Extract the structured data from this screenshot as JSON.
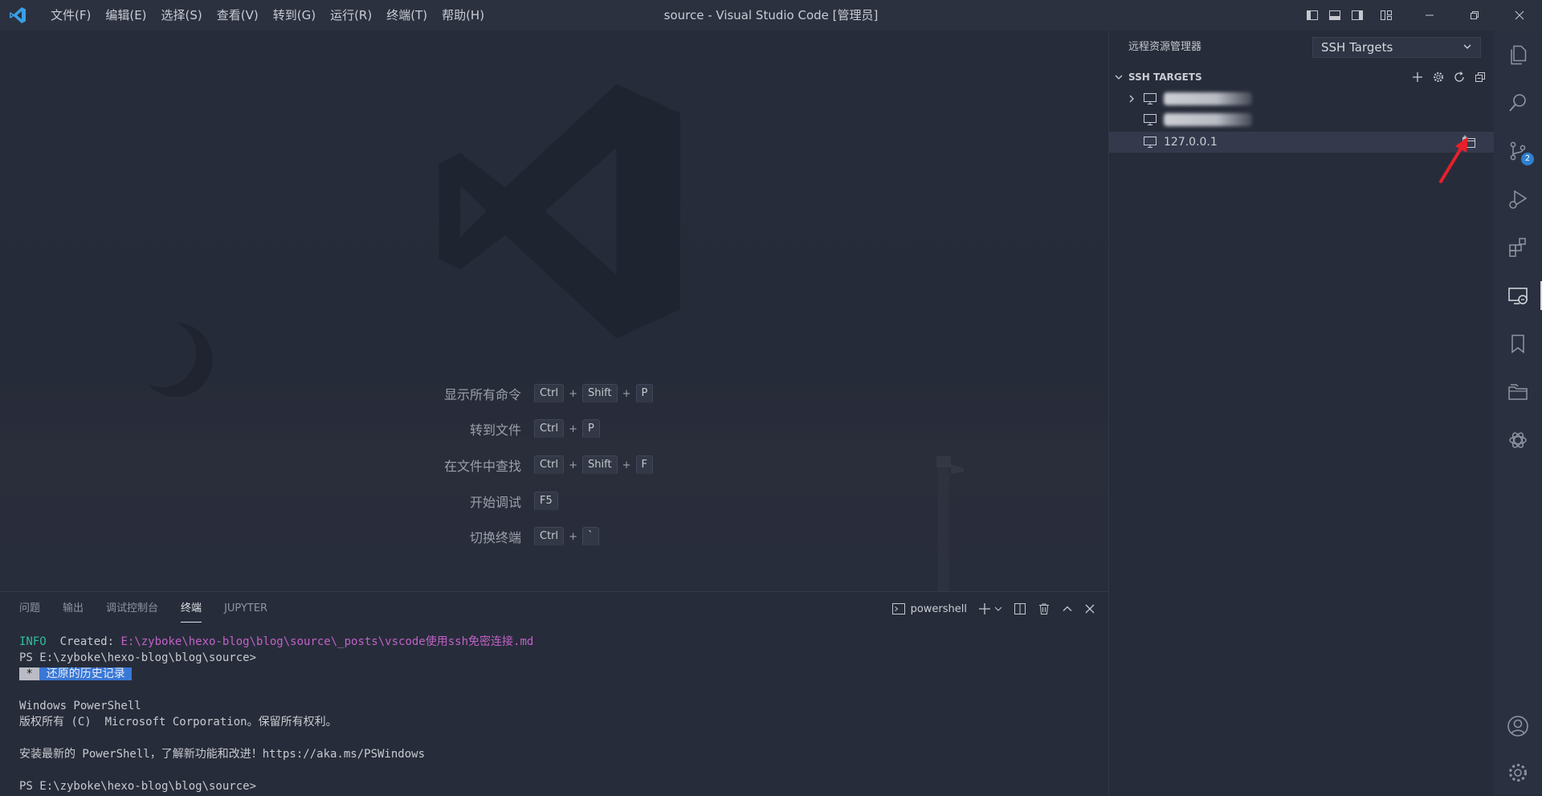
{
  "titlebar": {
    "menu": [
      "文件(F)",
      "编辑(E)",
      "选择(S)",
      "查看(V)",
      "转到(G)",
      "运行(R)",
      "终端(T)",
      "帮助(H)"
    ],
    "window_title": "source - Visual Studio Code [管理员]"
  },
  "editor": {
    "shortcuts": [
      {
        "label": "显示所有命令",
        "keys": [
          "Ctrl",
          "Shift",
          "P"
        ]
      },
      {
        "label": "转到文件",
        "keys": [
          "Ctrl",
          "P"
        ]
      },
      {
        "label": "在文件中查找",
        "keys": [
          "Ctrl",
          "Shift",
          "F"
        ]
      },
      {
        "label": "开始调试",
        "keys": [
          "F5"
        ]
      },
      {
        "label": "切换终端",
        "keys": [
          "Ctrl",
          "`"
        ]
      }
    ]
  },
  "panel": {
    "tabs": [
      "问题",
      "输出",
      "调试控制台",
      "终端",
      "JUPYTER"
    ],
    "active_tab": "终端",
    "terminal_name": "powershell",
    "lines": {
      "l1_level": "INFO",
      "l1_text": "  Created: ",
      "l1_path": "E:\\zyboke\\hexo-blog\\blog\\source\\_posts\\vscode使用ssh免密连接.md",
      "l2": "PS E:\\zyboke\\hexo-blog\\blog\\source>",
      "l3_star": " * ",
      "l3_text": " 还原的历史记录 ",
      "l5": "Windows PowerShell",
      "l6": "版权所有 (C)  Microsoft Corporation。保留所有权利。",
      "l8": "安装最新的 PowerShell，了解新功能和改进！https://aka.ms/PSWindows",
      "l10": "PS E:\\zyboke\\hexo-blog\\blog\\source>"
    }
  },
  "sidebar": {
    "header": "远程资源管理器",
    "select_value": "SSH Targets",
    "section_title": "SSH TARGETS",
    "hosts": [
      {
        "label": "",
        "redacted": true,
        "expandable": true
      },
      {
        "label": "",
        "redacted": true,
        "expandable": false
      },
      {
        "label": "127.0.0.1",
        "redacted": false,
        "expandable": false,
        "selected": true
      }
    ]
  },
  "activitybar": {
    "items": [
      "explorer-icon",
      "search-icon",
      "source-control-icon",
      "run-debug-icon",
      "extensions-icon",
      "remote-explorer-icon",
      "bookmarks-icon",
      "project-manager-icon",
      "chatgpt-icon"
    ],
    "source_control_badge": "2",
    "bottom": [
      "account-icon",
      "manage-gear-icon"
    ]
  },
  "colors": {
    "accent": "#2f80d0",
    "annotation_arrow": "#e8202a",
    "logo": "#3a9fe6"
  }
}
